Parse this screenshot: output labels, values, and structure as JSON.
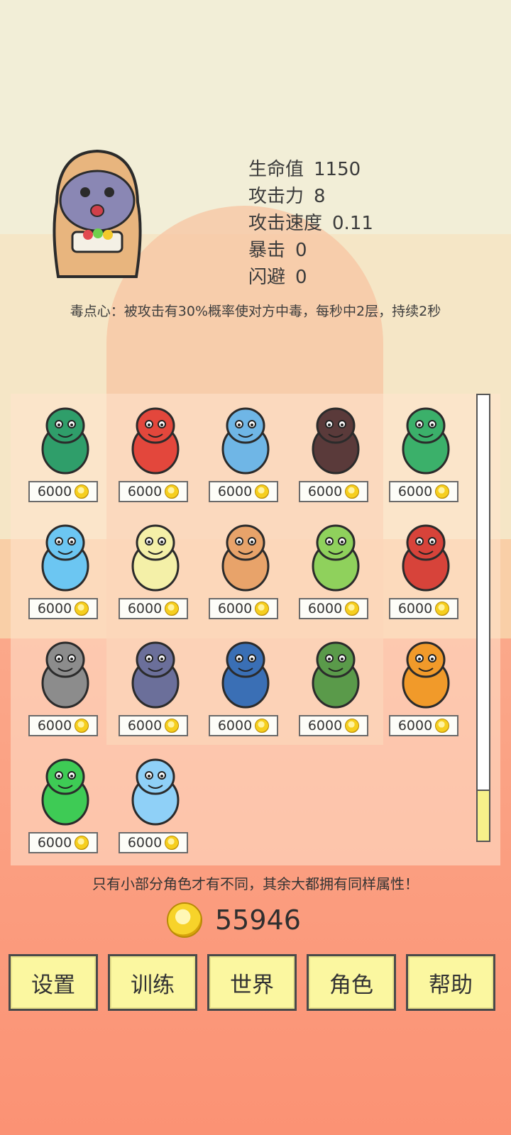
{
  "hero": {
    "stats": [
      {
        "label": "生命值",
        "value": "1150"
      },
      {
        "label": "攻击力",
        "value": "8"
      },
      {
        "label": "攻击速度",
        "value": "0.11"
      },
      {
        "label": "暴击",
        "value": "0"
      },
      {
        "label": "闪避",
        "value": "0"
      }
    ],
    "ability": "毒点心：被攻击有30%概率使对方中毒，每秒中2层，持续2秒"
  },
  "roster": {
    "characters": [
      {
        "name": "green-crocodile-warrior",
        "price": "6000",
        "color": "#2f9e6a"
      },
      {
        "name": "red-fox-with-pink-pig",
        "price": "6000",
        "color": "#e3473c"
      },
      {
        "name": "blue-shark-warrior",
        "price": "6000",
        "color": "#6fb6e6"
      },
      {
        "name": "dark-rock-golem",
        "price": "6000",
        "color": "#5a3a3a"
      },
      {
        "name": "mermaid-with-trident",
        "price": "6000",
        "color": "#3bb06a"
      },
      {
        "name": "blue-furry-monster",
        "price": "6000",
        "color": "#6cc6f2"
      },
      {
        "name": "yellow-duck-ninja",
        "price": "6000",
        "color": "#f4f0a8"
      },
      {
        "name": "spiky-serpent",
        "price": "6000",
        "color": "#e8a36a"
      },
      {
        "name": "green-frog-dragon",
        "price": "6000",
        "color": "#8fd15c"
      },
      {
        "name": "red-horned-mage",
        "price": "6000",
        "color": "#d7433a"
      },
      {
        "name": "grey-blob-ghost",
        "price": "6000",
        "color": "#8c8c8c"
      },
      {
        "name": "three-headed-dog",
        "price": "6000",
        "color": "#6b6f9a"
      },
      {
        "name": "blue-bat",
        "price": "6000",
        "color": "#3a6fb5"
      },
      {
        "name": "green-shrub-creature",
        "price": "6000",
        "color": "#5a9a4a"
      },
      {
        "name": "fire-elemental",
        "price": "6000",
        "color": "#f19a2a"
      },
      {
        "name": "green-spring-slime",
        "price": "6000",
        "color": "#3ecb55"
      },
      {
        "name": "blue-water-spirit",
        "price": "6000",
        "color": "#8fd0f7"
      }
    ]
  },
  "note": "只有小部分角色才有不同，其余大都拥有同样属性！",
  "wallet": {
    "coins": "55946"
  },
  "nav": [
    {
      "id": "settings",
      "label": "设置"
    },
    {
      "id": "training",
      "label": "训练"
    },
    {
      "id": "world",
      "label": "世界"
    },
    {
      "id": "character",
      "label": "角色"
    },
    {
      "id": "help",
      "label": "帮助"
    }
  ]
}
